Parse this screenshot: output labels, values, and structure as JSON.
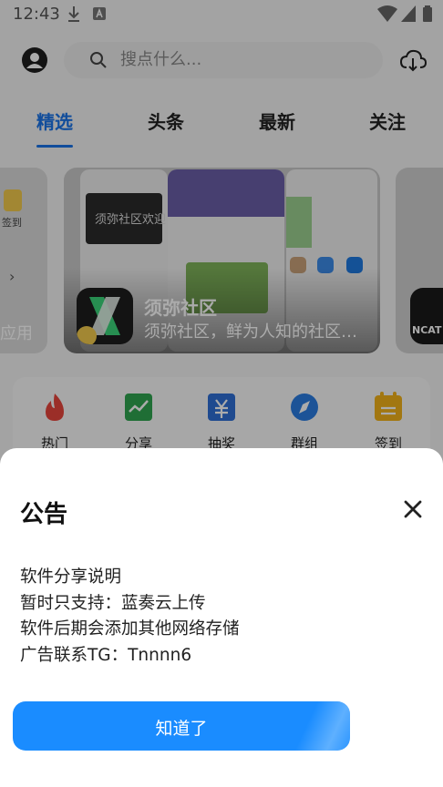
{
  "status_bar": {
    "time": "12:43"
  },
  "search": {
    "placeholder": "搜点什么..."
  },
  "tabs": [
    {
      "label": "精选",
      "active": true
    },
    {
      "label": "头条"
    },
    {
      "label": "最新"
    },
    {
      "label": "关注"
    }
  ],
  "carousel": {
    "left_card": {
      "sign_label": "签到",
      "bottom_text": "应用"
    },
    "main_card": {
      "title": "须弥社区",
      "subtitle": "须弥社区，鲜为人知的社区…",
      "preview_text": "须弥社区欢迎"
    },
    "right_card": {
      "logo_text": "NCAT"
    }
  },
  "quick_actions": [
    {
      "label": "热门",
      "icon": "fire-icon",
      "color": "#e8453c"
    },
    {
      "label": "分享",
      "icon": "chart-icon",
      "color": "#2fa44f"
    },
    {
      "label": "抽奖",
      "icon": "lottery-icon",
      "color": "#2f6fd6"
    },
    {
      "label": "群组",
      "icon": "compass-icon",
      "color": "#2a7de1"
    },
    {
      "label": "签到",
      "icon": "calendar-icon",
      "color": "#f2b21a"
    }
  ],
  "dialog": {
    "title": "公告",
    "lines": [
      "软件分享说明",
      "暂时只支持：蓝奏云上传",
      "软件后期会添加其他网络存储",
      "广告联系TG：Tnnnn6"
    ],
    "confirm_label": "知道了"
  },
  "colors": {
    "accent": "#1a73e8",
    "button": "#1a8cff"
  }
}
